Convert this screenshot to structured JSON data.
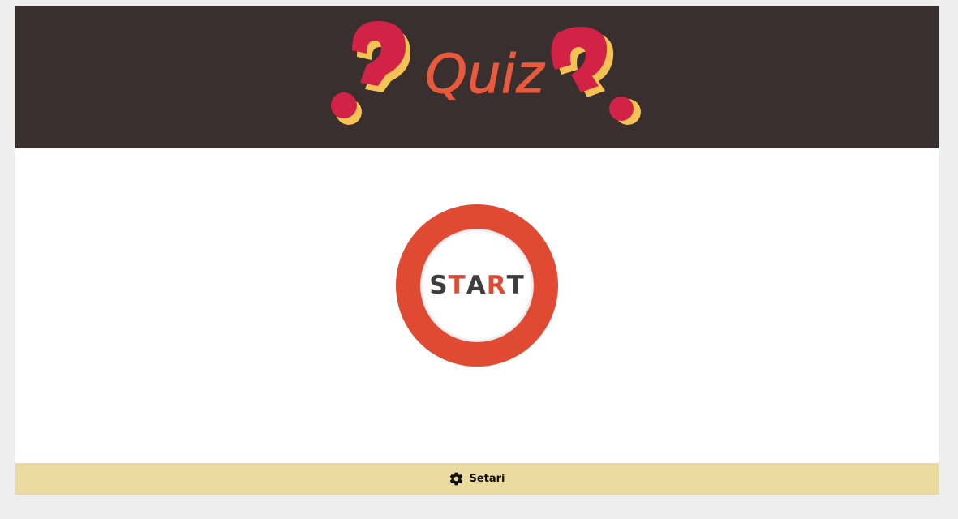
{
  "header": {
    "logo_text": "Quiz",
    "logo_colors": {
      "background": "#3a2f2f",
      "question_mark_red": "#d22246",
      "question_mark_yellow": "#f5c254",
      "quiz_text": "#e85a3c"
    }
  },
  "main": {
    "start_button": {
      "letters": [
        {
          "char": "S",
          "accent": false
        },
        {
          "char": "T",
          "accent": true
        },
        {
          "char": "A",
          "accent": false
        },
        {
          "char": "R",
          "accent": true
        },
        {
          "char": "T",
          "accent": false
        }
      ],
      "ring_color": "#e04a33",
      "text_color": "#3e3e3e"
    }
  },
  "footer": {
    "settings_label": "Setari",
    "settings_icon": "gear-icon",
    "background": "#ebdb9f"
  }
}
